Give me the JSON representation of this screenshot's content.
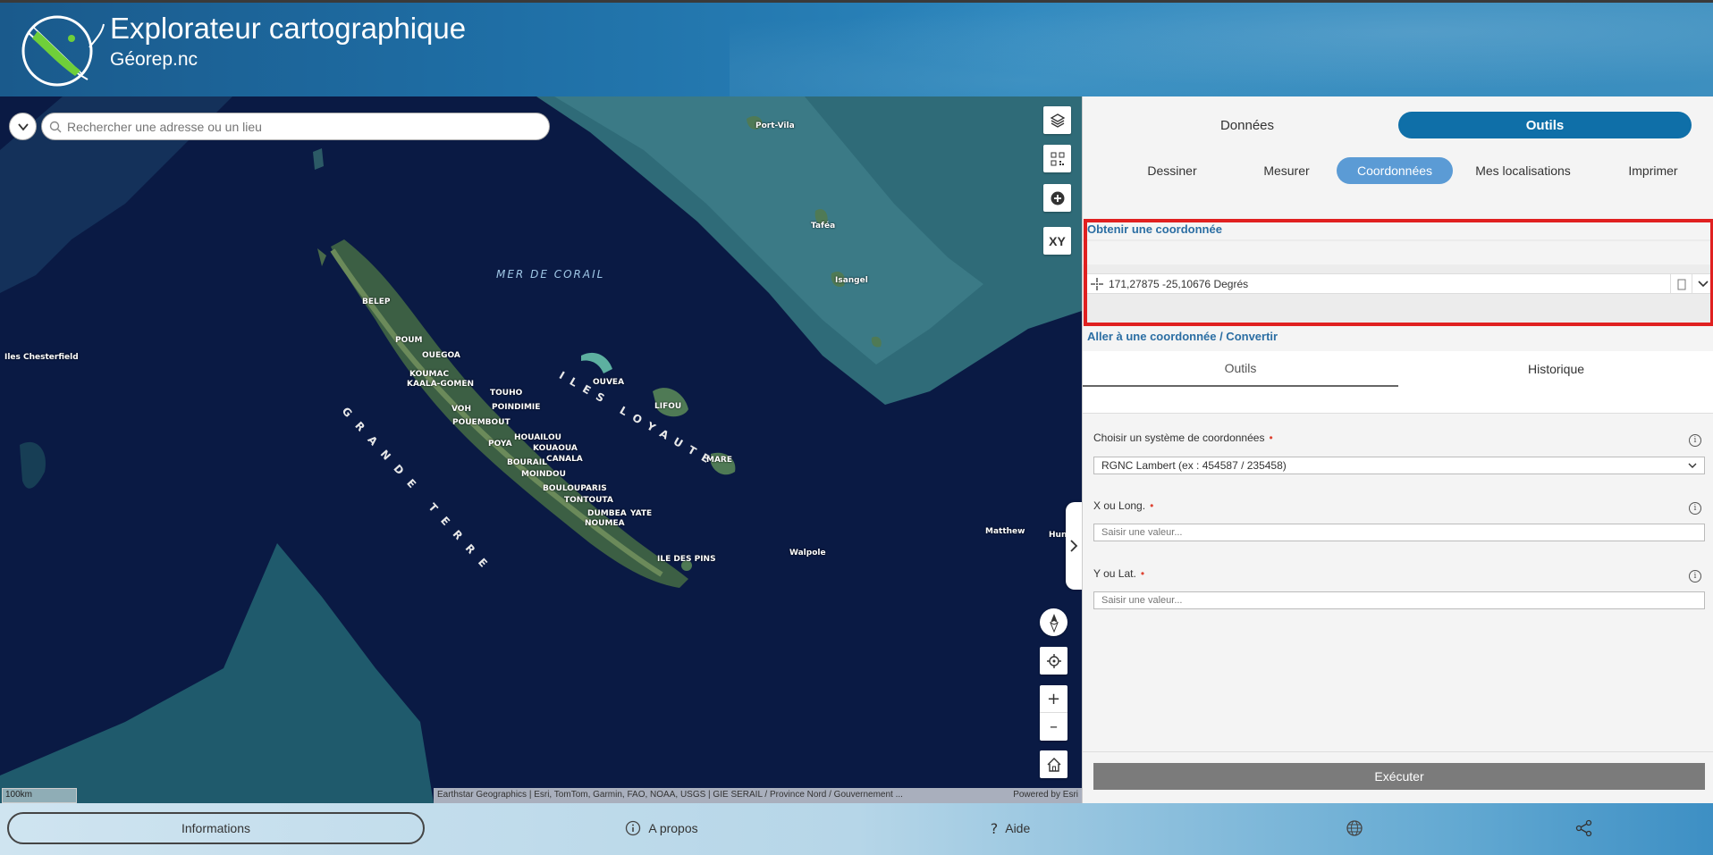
{
  "app": {
    "title": "Explorateur cartographique",
    "subtitle": "Géorep.nc"
  },
  "search": {
    "placeholder": "Rechercher une adresse ou un lieu"
  },
  "map_tools": {
    "layers_icon": "layers-icon",
    "qr_icon": "qr-code-icon",
    "add_icon": "add-circle-icon",
    "xy_label": "XY",
    "compass_icon": "compass-icon",
    "locate_icon": "locate-icon",
    "zoom_in": "+",
    "zoom_out": "–",
    "home_icon": "home-icon"
  },
  "map_labels": {
    "sea": "MER DE CORAIL",
    "grande_terre": "GRANDE TERRE",
    "iles_loyaute": "ILES LOYAUTE",
    "places": [
      "Port-Vila",
      "Taféa",
      "Isangel",
      "Iles Chesterfield",
      "BELEP",
      "POUM",
      "OUEGOA",
      "KOUMAC",
      "KAALA-GOMEN",
      "TOUHO",
      "POINDIMIE",
      "OUVEA",
      "VOH",
      "POUEMBOUT",
      "LIFOU",
      "HOUAILOU",
      "KOUAOUA",
      "POYA",
      "CANALA",
      "BOURAIL",
      "MOINDOU",
      "MARE",
      "BOULOUPARIS",
      "TONTOUTA",
      "DUMBEA",
      "YATE",
      "NOUMEA",
      "ILE DES PINS",
      "Walpole",
      "Matthew",
      "Hunter"
    ]
  },
  "attribution": {
    "text": "Earthstar Geographics | Esri, TomTom, Garmin, FAO, NOAA, USGS | GIE SERAIL / Province Nord / Gouvernement ...",
    "powered": "Powered by Esri"
  },
  "scalebar": "100km",
  "panel": {
    "top_tabs": [
      "Données",
      "Outils"
    ],
    "active_top_tab": "Outils",
    "sub_tabs": [
      "Dessiner",
      "Mesurer",
      "Coordonnées",
      "Mes localisations",
      "Imprimer"
    ],
    "active_sub_tab": "Coordonnées",
    "get_coord_title": "Obtenir une coordonnée",
    "coord_value": "171,27875 -25,10676 Degrés",
    "goto_title": "Aller à une coordonnée / Convertir",
    "inner_tabs": [
      "Outils",
      "Historique"
    ],
    "form": {
      "system_label": "Choisir un système de coordonnées",
      "system_value": "RGNC Lambert (ex : 454587 / 235458)",
      "x_label": "X ou Long.",
      "x_placeholder": "Saisir une valeur...",
      "y_label": "Y ou Lat.",
      "y_placeholder": "Saisir une valeur...",
      "required_mark": "•",
      "info_mark": "i"
    },
    "execute_label": "Exécuter"
  },
  "footer": {
    "informations": "Informations",
    "apropos": "A propos",
    "aide": "Aide",
    "language_icon": "globe-icon",
    "share_icon": "share-icon"
  },
  "colors": {
    "accent": "#0f6fa8",
    "active_subtab": "#5b9bd5",
    "highlight_border": "#e02020",
    "execute_button": "#7b7b7b"
  }
}
